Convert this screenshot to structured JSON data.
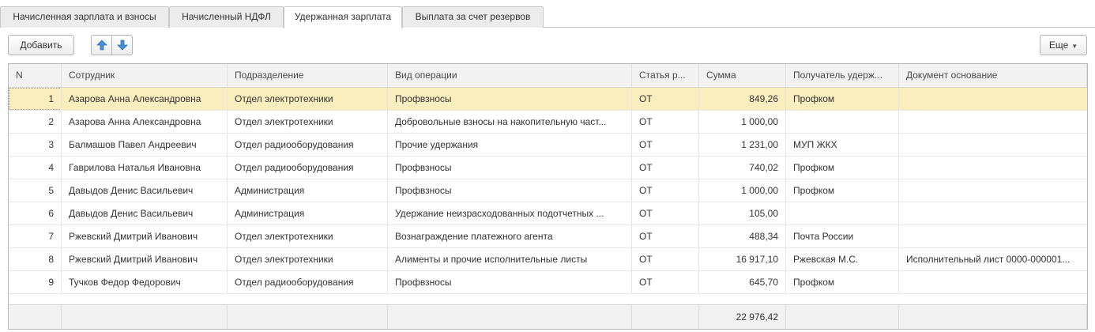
{
  "tabs": [
    {
      "label": "Начисленная зарплата и взносы"
    },
    {
      "label": "Начисленный НДФЛ"
    },
    {
      "label": "Удержанная зарплата"
    },
    {
      "label": "Выплата за счет резервов"
    }
  ],
  "toolbar": {
    "add_label": "Добавить",
    "more_label": "Еще",
    "up_icon": "arrow-up-icon",
    "down_icon": "arrow-down-icon"
  },
  "colors": {
    "accent_arrow": "#4a8fd6",
    "selected_row": "#fbeebe"
  },
  "table": {
    "columns": [
      "N",
      "Сотрудник",
      "Подразделение",
      "Вид операции",
      "Статья р...",
      "Сумма",
      "Получатель удерж...",
      "Документ основание"
    ],
    "rows": [
      {
        "n": "1",
        "employee": "Азарова Анна Александровна",
        "department": "Отдел электротехники",
        "operation": "Профвзносы",
        "article": "ОТ",
        "sum": "849,26",
        "recipient": "Профком",
        "document": ""
      },
      {
        "n": "2",
        "employee": "Азарова Анна Александровна",
        "department": "Отдел электротехники",
        "operation": "Добровольные взносы на накопительную част...",
        "article": "ОТ",
        "sum": "1 000,00",
        "recipient": "",
        "document": ""
      },
      {
        "n": "3",
        "employee": "Балмашов Павел Андреевич",
        "department": "Отдел радиооборудования",
        "operation": "Прочие удержания",
        "article": "ОТ",
        "sum": "1 231,00",
        "recipient": "МУП ЖКХ",
        "document": ""
      },
      {
        "n": "4",
        "employee": "Гаврилова Наталья Ивановна",
        "department": "Отдел радиооборудования",
        "operation": "Профвзносы",
        "article": "ОТ",
        "sum": "740,02",
        "recipient": "Профком",
        "document": ""
      },
      {
        "n": "5",
        "employee": "Давыдов Денис Васильевич",
        "department": "Администрация",
        "operation": "Профвзносы",
        "article": "ОТ",
        "sum": "1 000,00",
        "recipient": "Профком",
        "document": ""
      },
      {
        "n": "6",
        "employee": "Давыдов Денис Васильевич",
        "department": "Администрация",
        "operation": "Удержание неизрасходованных подотчетных ...",
        "article": "ОТ",
        "sum": "105,00",
        "recipient": "",
        "document": ""
      },
      {
        "n": "7",
        "employee": "Ржевский Дмитрий Иванович",
        "department": "Отдел электротехники",
        "operation": "Вознаграждение платежного агента",
        "article": "ОТ",
        "sum": "488,34",
        "recipient": "Почта России",
        "document": ""
      },
      {
        "n": "8",
        "employee": "Ржевский Дмитрий Иванович",
        "department": "Отдел электротехники",
        "operation": "Алименты и прочие исполнительные листы",
        "article": "ОТ",
        "sum": "16 917,10",
        "recipient": "Ржевская М.С.",
        "document": "Исполнительный лист 0000-000001..."
      },
      {
        "n": "9",
        "employee": "Тучков Федор Федорович",
        "department": "Отдел радиооборудования",
        "operation": "Профвзносы",
        "article": "ОТ",
        "sum": "645,70",
        "recipient": "Профком",
        "document": ""
      }
    ],
    "total_sum": "22 976,42"
  }
}
